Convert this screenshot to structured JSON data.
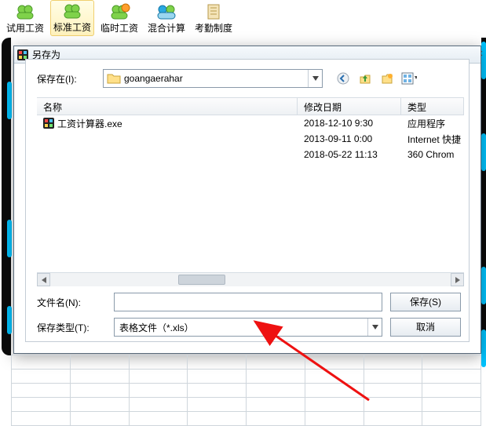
{
  "toolbar": {
    "items": [
      {
        "label": "试用工资"
      },
      {
        "label": "标准工资"
      },
      {
        "label": "临时工资"
      },
      {
        "label": "混合计算"
      },
      {
        "label": "考勤制度"
      }
    ],
    "selected_index": 1
  },
  "dialog": {
    "title": "另存为",
    "save_in_label": "保存在(I):",
    "location": "goangaerahar",
    "nav_icons": [
      "back-icon",
      "up-icon",
      "new-folder-icon",
      "views-icon"
    ],
    "columns": {
      "name": "名称",
      "date": "修改日期",
      "type": "类型"
    },
    "rows": [
      {
        "name": "工资计算器.exe",
        "date": "2018-12-10 9:30",
        "type": "应用程序",
        "icon": "app-icon"
      },
      {
        "name": "",
        "date": "2013-09-11 0:00",
        "type": "Internet 快捷"
      },
      {
        "name": "",
        "date": "2018-05-22 11:13",
        "type": "360 Chrom"
      }
    ],
    "filename_label": "文件名(N):",
    "filename_value": "",
    "filetype_label": "保存类型(T):",
    "filetype_value": "表格文件（*.xls）",
    "save_btn": "保存(S)",
    "cancel_btn": "取消"
  },
  "close_x": "×"
}
